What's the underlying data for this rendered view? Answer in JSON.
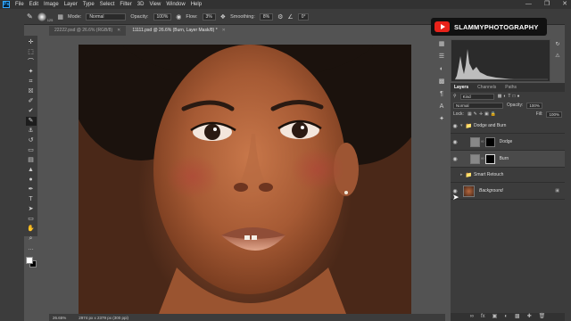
{
  "menu": {
    "app_icon": "Ps",
    "items": [
      "File",
      "Edit",
      "Image",
      "Layer",
      "Type",
      "Select",
      "Filter",
      "3D",
      "View",
      "Window",
      "Help"
    ],
    "window_controls": [
      "—",
      "❐",
      "✕"
    ]
  },
  "options": {
    "brush_size": "125",
    "mode_label": "Mode:",
    "mode_value": "Normal",
    "opacity_label": "Opacity:",
    "opacity_value": "100%",
    "flow_label": "Flow:",
    "flow_value": "3%",
    "smoothing_label": "Smoothing:",
    "smoothing_value": "8%",
    "angle_value": "0°"
  },
  "watermark": {
    "channel": "SLAMMYPHOTOGRAPHY",
    "icon": "youtube-play-icon"
  },
  "tabs": [
    {
      "label": "22222.psd @ 26.6% (RGB/8)",
      "close": "✕",
      "active": false
    },
    {
      "label": "11111.psd @ 26.6% (Burn, Layer Mask/8) *",
      "close": "✕",
      "active": true
    }
  ],
  "toolbar": {
    "tools": [
      {
        "name": "move-tool-icon",
        "glyph": "✛"
      },
      {
        "name": "marquee-tool-icon",
        "glyph": "⬚"
      },
      {
        "name": "lasso-tool-icon",
        "glyph": "⌒"
      },
      {
        "name": "quick-select-tool-icon",
        "glyph": "✦"
      },
      {
        "name": "crop-tool-icon",
        "glyph": "⌗"
      },
      {
        "name": "frame-tool-icon",
        "glyph": "☒"
      },
      {
        "name": "eyedropper-tool-icon",
        "glyph": "✐"
      },
      {
        "name": "healing-tool-icon",
        "glyph": "✔"
      },
      {
        "name": "brush-tool-icon",
        "glyph": "✎"
      },
      {
        "name": "stamp-tool-icon",
        "glyph": "⚓"
      },
      {
        "name": "history-brush-icon",
        "glyph": "↺"
      },
      {
        "name": "eraser-tool-icon",
        "glyph": "▭"
      },
      {
        "name": "gradient-tool-icon",
        "glyph": "▤"
      },
      {
        "name": "blur-tool-icon",
        "glyph": "▲"
      },
      {
        "name": "dodge-tool-icon",
        "glyph": "●"
      },
      {
        "name": "pen-tool-icon",
        "glyph": "✒"
      },
      {
        "name": "type-tool-icon",
        "glyph": "T"
      },
      {
        "name": "path-select-tool-icon",
        "glyph": "➤"
      },
      {
        "name": "shape-tool-icon",
        "glyph": "▭"
      },
      {
        "name": "hand-tool-icon",
        "glyph": "✋"
      },
      {
        "name": "zoom-tool-icon",
        "glyph": "⌕"
      },
      {
        "name": "more-tools-icon",
        "glyph": "…"
      }
    ],
    "active_tool": 8
  },
  "layers": {
    "tabs": [
      "Layers",
      "Channels",
      "Paths"
    ],
    "kind_label": "Kind",
    "blend_mode": "Normal",
    "opacity_label": "Opacity:",
    "opacity_value": "100%",
    "lock_label": "Lock:",
    "fill_label": "Fill:",
    "fill_value": "100%",
    "items": [
      {
        "name": "Dodge and Burn",
        "type": "group"
      },
      {
        "name": "Dodge",
        "type": "layer"
      },
      {
        "name": "Burn",
        "type": "layer",
        "selected": true
      },
      {
        "name": "Smart Retouch",
        "type": "group"
      },
      {
        "name": "Background",
        "type": "background"
      }
    ]
  },
  "status": {
    "zoom": "26.65%",
    "doc_size": "2974 px x 2379 px (300 ppi)"
  },
  "colors": {
    "accent": "#31a8ff",
    "yt_red": "#e8221a",
    "skin": "#b5683f"
  }
}
